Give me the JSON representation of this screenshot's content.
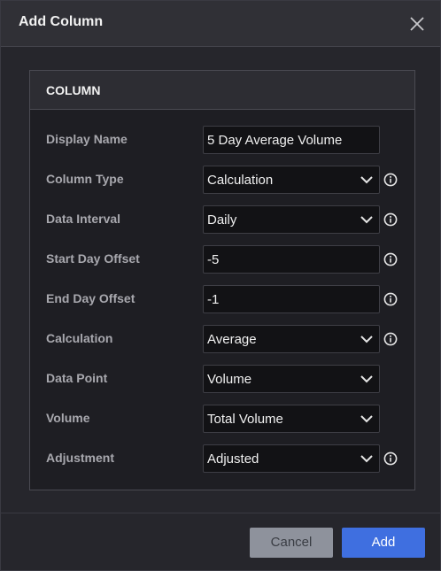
{
  "dialog": {
    "title": "Add Column",
    "close_icon": "close-icon"
  },
  "panel": {
    "title": "COLUMN"
  },
  "fields": {
    "display_name": {
      "label": "Display Name",
      "value": "5 Day Average Volume"
    },
    "column_type": {
      "label": "Column Type",
      "value": "Calculation"
    },
    "data_interval": {
      "label": "Data Interval",
      "value": "Daily"
    },
    "start_day_offset": {
      "label": "Start Day Offset",
      "value": "-5"
    },
    "end_day_offset": {
      "label": "End Day Offset",
      "value": "-1"
    },
    "calculation": {
      "label": "Calculation",
      "value": "Average"
    },
    "data_point": {
      "label": "Data Point",
      "value": "Volume"
    },
    "volume": {
      "label": "Volume",
      "value": "Total Volume"
    },
    "adjustment": {
      "label": "Adjustment",
      "value": "Adjusted"
    }
  },
  "buttons": {
    "cancel_label": "Cancel",
    "add_label": "Add"
  },
  "colors": {
    "accent": "#3f6fe0",
    "background": "#26262c",
    "field_background": "#121215"
  }
}
